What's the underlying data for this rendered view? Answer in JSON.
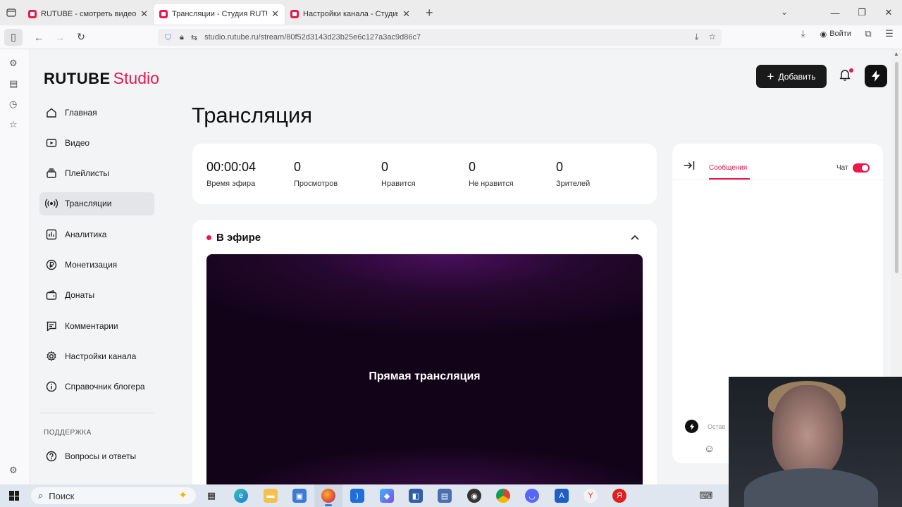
{
  "browser": {
    "tabs": [
      {
        "title": "RUTUBE - смотреть видео онл",
        "active": false
      },
      {
        "title": "Трансляции - Студия RUTUBE",
        "active": true
      },
      {
        "title": "Настройки канала - Студия RU",
        "active": false
      }
    ],
    "url": "studio.rutube.ru/stream/80f52d3143d23b25e6c127a3ac9d86c7",
    "login_label": "Войти"
  },
  "logo": {
    "main": "RUTUBE",
    "suffix": "Studio",
    "accent_color": "#e8194c"
  },
  "menu": {
    "items": [
      {
        "label": "Главная",
        "icon": "home-icon"
      },
      {
        "label": "Видео",
        "icon": "video-icon"
      },
      {
        "label": "Плейлисты",
        "icon": "playlist-icon"
      },
      {
        "label": "Трансляции",
        "icon": "broadcast-icon",
        "active": true
      },
      {
        "label": "Аналитика",
        "icon": "analytics-icon"
      },
      {
        "label": "Монетизация",
        "icon": "ruble-icon"
      },
      {
        "label": "Донаты",
        "icon": "wallet-icon"
      },
      {
        "label": "Комментарии",
        "icon": "comments-icon"
      },
      {
        "label": "Настройки канала",
        "icon": "gear-icon"
      },
      {
        "label": "Справочник блогера",
        "icon": "info-icon"
      }
    ],
    "support_heading": "ПОДДЕРЖКА",
    "faq_label": "Вопросы и ответы"
  },
  "header": {
    "add_label": "Добавить"
  },
  "page": {
    "title": "Трансляция"
  },
  "stats": [
    {
      "value": "00:00:04",
      "label": "Время эфира"
    },
    {
      "value": "0",
      "label": "Просмотров"
    },
    {
      "value": "0",
      "label": "Нравится"
    },
    {
      "value": "0",
      "label": "Не нравится"
    },
    {
      "value": "0",
      "label": "Зрителей"
    }
  ],
  "stream": {
    "status": "В эфире",
    "player_text": "Прямая трансляция"
  },
  "chat": {
    "tab_messages": "Сообщения",
    "chat_label": "Чат",
    "chat_enabled": true,
    "input_placeholder": "Остав"
  },
  "taskbar": {
    "search_label": "Поиск"
  }
}
